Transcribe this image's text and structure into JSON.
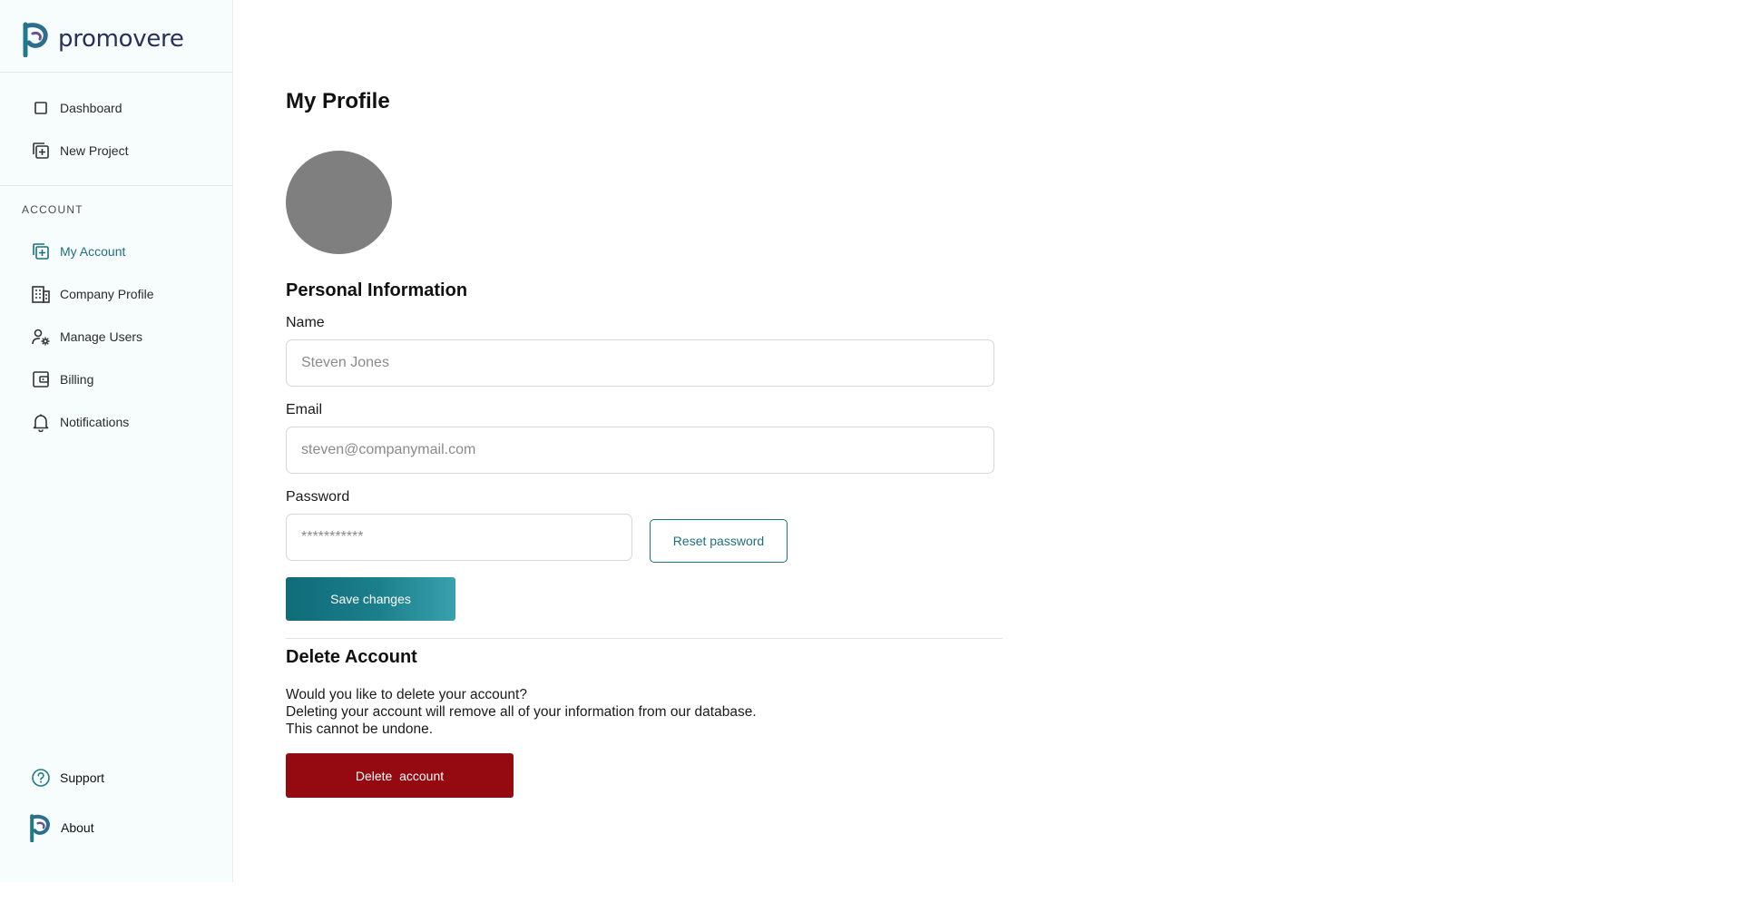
{
  "brand": {
    "name": "promovere",
    "color": "#2b2f5a",
    "accent": "#1f7a89"
  },
  "sidebar": {
    "nav": [
      {
        "label": "Dashboard",
        "icon": "square-icon"
      },
      {
        "label": "New Project",
        "icon": "add-project-icon"
      }
    ],
    "account_section_label": "ACCOUNT",
    "account_items": [
      {
        "label": "My Account",
        "icon": "add-project-icon",
        "active": true
      },
      {
        "label": "Company Profile",
        "icon": "building-icon"
      },
      {
        "label": "Manage Users",
        "icon": "user-gear-icon"
      },
      {
        "label": "Billing",
        "icon": "wallet-icon"
      },
      {
        "label": "Notifications",
        "icon": "bell-icon"
      }
    ],
    "footer_items": [
      {
        "label": "Support",
        "icon": "help-icon"
      },
      {
        "label": "About",
        "icon": "logo-icon"
      }
    ]
  },
  "main": {
    "title": "My Profile",
    "personal_info_title": "Personal Information",
    "name": {
      "label": "Name",
      "placeholder": "Steven Jones"
    },
    "email": {
      "label": "Email",
      "placeholder": "steven@companymail.com"
    },
    "password": {
      "label": "Password",
      "placeholder": "***********"
    },
    "reset_password_label": "Reset password",
    "save_label": "Save changes",
    "delete_section": {
      "title": "Delete Account",
      "lines": [
        "Would you like to delete your account?",
        "Deleting your account will remove all of your information from our database.",
        "This cannot be undone."
      ],
      "button_label": "Delete  account"
    }
  }
}
